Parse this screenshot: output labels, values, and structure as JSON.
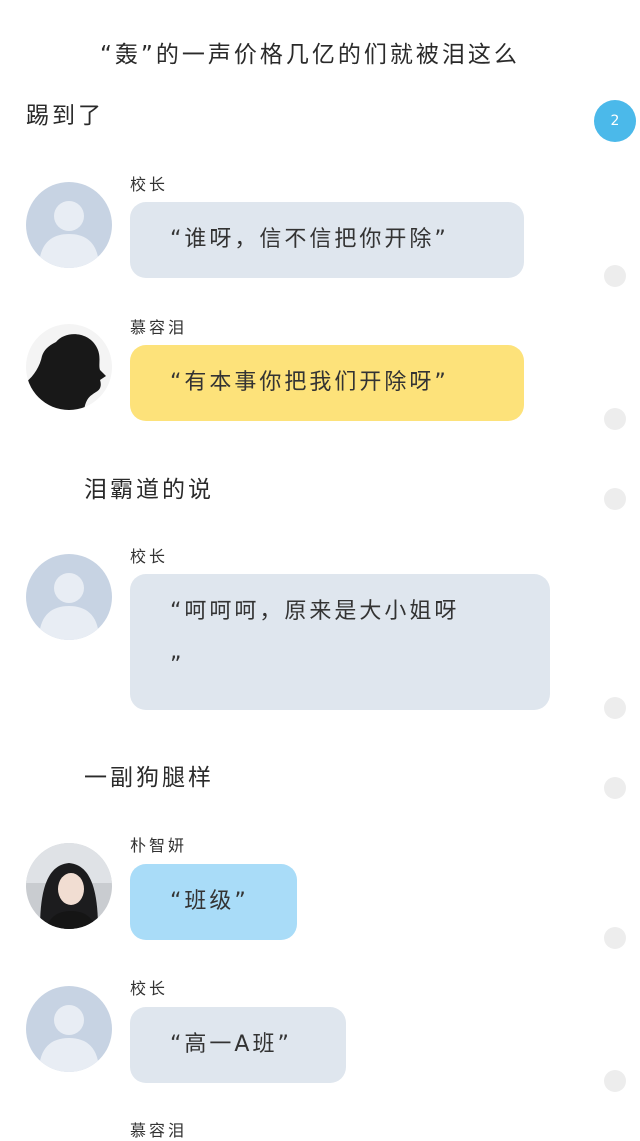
{
  "story": {
    "intro_line1": "“轰”的一声价格几亿的们就被泪这么",
    "intro_line2": "踢到了",
    "narration_1": "泪霸道的说",
    "narration_2": "一副狗腿样"
  },
  "comment_badge": {
    "count": "2"
  },
  "messages": [
    {
      "speaker": "校长",
      "text": "“谁呀，信不信把你开除”",
      "bubble_color": "#dfe6ee",
      "avatar": "default-avatar"
    },
    {
      "speaker": "慕容泪",
      "text": "“有本事你把我们开除呀”",
      "bubble_color": "#fde27a",
      "avatar": "silhouette-avatar"
    },
    {
      "speaker": "校长",
      "text_line1": "“呵呵呵，原来是大小姐呀",
      "text_line2": "”",
      "bubble_color": "#dfe6ee",
      "avatar": "default-avatar"
    },
    {
      "speaker": "朴智妍",
      "text": "“班级”",
      "bubble_color": "#a9dcf8",
      "avatar": "photo-avatar"
    },
    {
      "speaker": "校长",
      "text": "“高一A班”",
      "bubble_color": "#dfe6ee",
      "avatar": "default-avatar"
    },
    {
      "speaker": "慕容泪"
    }
  ]
}
